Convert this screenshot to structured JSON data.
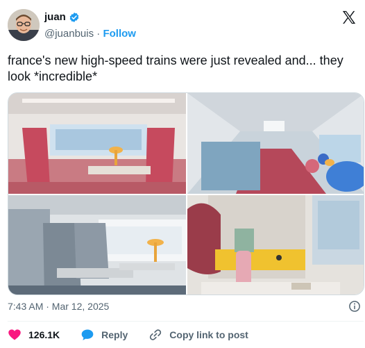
{
  "author": {
    "name": "juan",
    "handle": "@juanbuis",
    "separator": "·",
    "follow_label": "Follow",
    "verified_color": "#1d9bf0",
    "avatar_icon": "avatar"
  },
  "tweet": {
    "text": "france's new high-speed trains were just revealed and... they look *incredible*"
  },
  "media": {
    "photos": [
      "train-interior-photo-1",
      "train-interior-photo-2",
      "train-interior-photo-3",
      "train-interior-photo-4"
    ]
  },
  "meta": {
    "timestamp": "7:43 AM · Mar 12, 2025"
  },
  "actions": {
    "like_count": "126.1K",
    "reply_label": "Reply",
    "copy_label": "Copy link to post",
    "like_color": "#f91880",
    "reply_color": "#1d9bf0"
  }
}
